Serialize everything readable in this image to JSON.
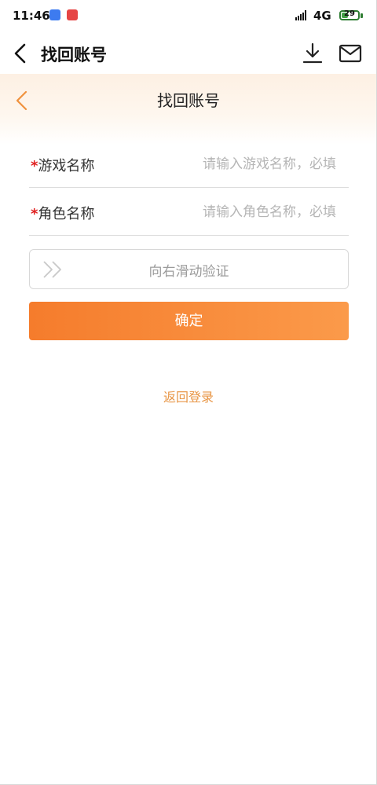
{
  "status_bar": {
    "time": "11:46",
    "network": "4G",
    "battery_level": "29",
    "notification_icons": [
      "app-notification-icon",
      "app-notification-icon"
    ]
  },
  "app_bar": {
    "title": "找回账号",
    "icons": [
      "back-arrow-icon",
      "download-icon",
      "mail-icon"
    ]
  },
  "page_header": {
    "title": "找回账号",
    "accent_color": "#f0923e"
  },
  "form": {
    "fields": [
      {
        "required_mark": "*",
        "label": "游戏名称",
        "placeholder": "请输入游戏名称，必填",
        "value": ""
      },
      {
        "required_mark": "*",
        "label": "角色名称",
        "placeholder": "请输入角色名称，必填",
        "value": ""
      }
    ],
    "slider": {
      "label": "向右滑动验证",
      "icon": "double-chevron-right-icon"
    },
    "confirm_label": "确定",
    "confirm_color": "#f57c2c"
  },
  "footer": {
    "login_link": "返回登录",
    "link_color": "#e89646"
  }
}
